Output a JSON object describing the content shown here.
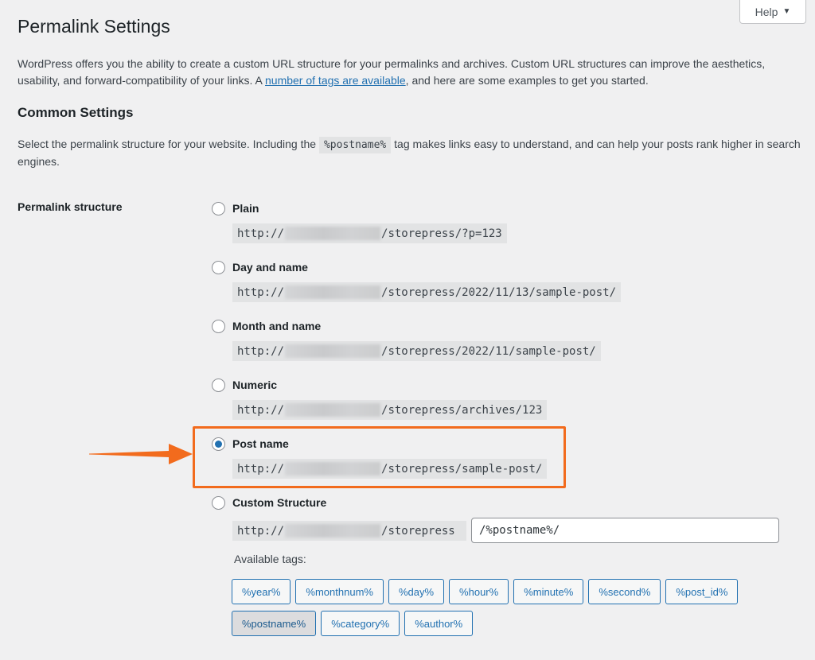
{
  "help": {
    "label": "Help",
    "caret": "▼"
  },
  "page_title": "Permalink Settings",
  "intro": {
    "before_link": "WordPress offers you the ability to create a custom URL structure for your permalinks and archives. Custom URL structures can improve the aesthetics, usability, and forward-compatibility of your links. A ",
    "link": "number of tags are available",
    "after_link": ", and here are some examples to get you started."
  },
  "common_settings": {
    "heading": "Common Settings",
    "desc_before": "Select the permalink structure for your website. Including the ",
    "desc_code": "%postname%",
    "desc_after": " tag makes links easy to understand, and can help your posts rank higher in search engines."
  },
  "permalink_structure": {
    "label": "Permalink structure",
    "url_prefix": "http://",
    "options": [
      {
        "label": "Plain",
        "suffix": "/storepress/?p=123",
        "checked": false
      },
      {
        "label": "Day and name",
        "suffix": "/storepress/2022/11/13/sample-post/",
        "checked": false
      },
      {
        "label": "Month and name",
        "suffix": "/storepress/2022/11/sample-post/",
        "checked": false
      },
      {
        "label": "Numeric",
        "suffix": "/storepress/archives/123",
        "checked": false
      },
      {
        "label": "Post name",
        "suffix": "/storepress/sample-post/",
        "checked": true
      },
      {
        "label": "Custom Structure",
        "suffix": "/storepress",
        "checked": false
      }
    ],
    "custom_value": "/%postname%/",
    "available_tags_label": "Available tags:",
    "tags_row1": [
      "%year%",
      "%monthnum%",
      "%day%",
      "%hour%",
      "%minute%",
      "%second%",
      "%post_id%"
    ],
    "tags_row2": [
      "%postname%",
      "%category%",
      "%author%"
    ],
    "active_tag": "%postname%"
  },
  "colors": {
    "highlight": "#f26b1d",
    "accent": "#2271b1"
  }
}
